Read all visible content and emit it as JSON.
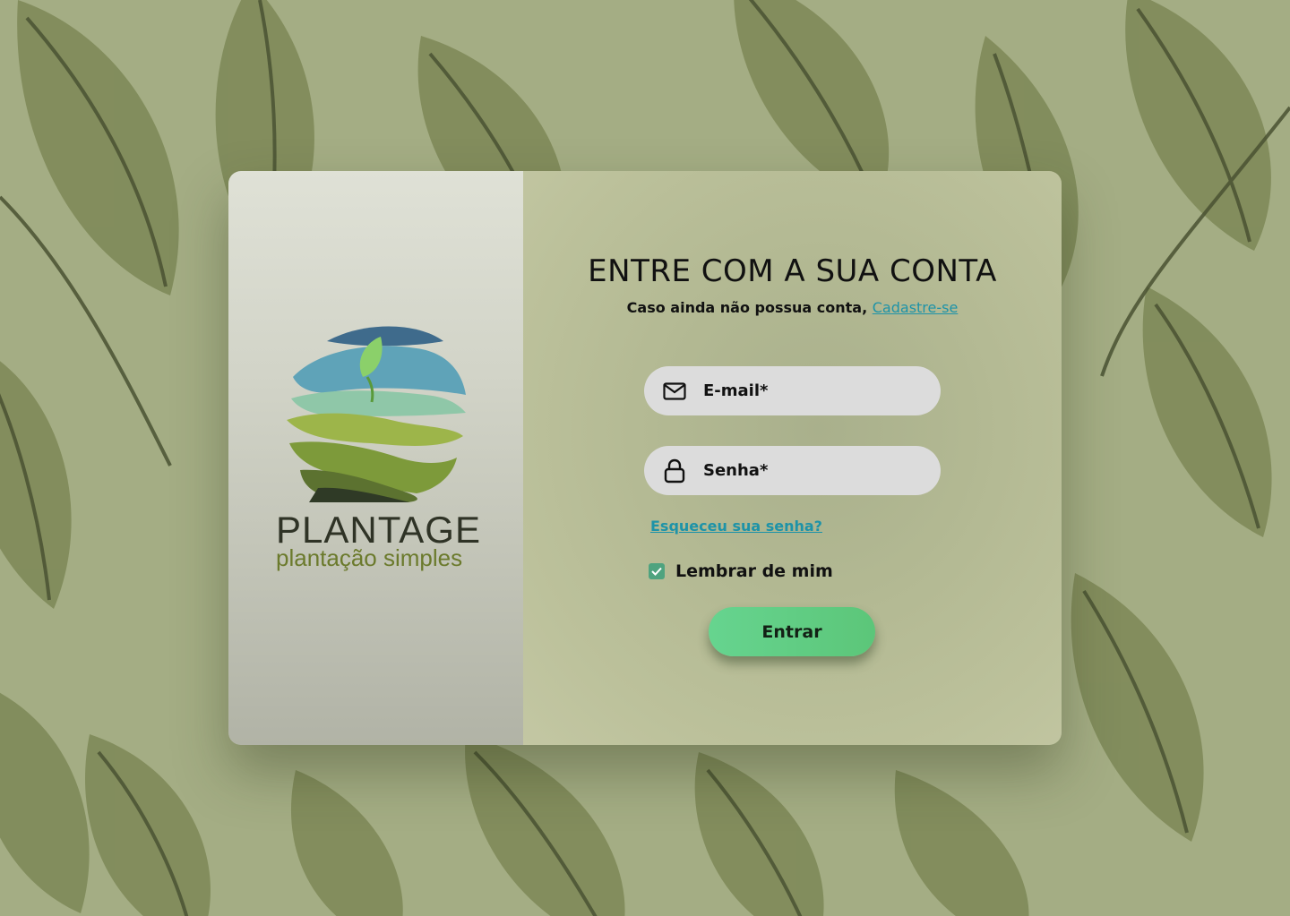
{
  "brand": {
    "name": "PLANTAGE",
    "tagline": "plantação simples"
  },
  "login": {
    "title": "ENTRE COM A SUA CONTA",
    "subtitle_text": "Caso ainda não possua conta,",
    "signup_link": "Cadastre-se",
    "email_placeholder": "E-mail*",
    "password_placeholder": "Senha*",
    "forgot_link": "Esqueceu sua senha?",
    "remember_label": "Lembrar de mim",
    "remember_checked": true,
    "submit_label": "Entrar"
  },
  "icons": {
    "email": "mail-icon",
    "password": "lock-icon",
    "checkbox": "check-icon"
  },
  "colors": {
    "link": "#1e93a8",
    "button": "#5cc679",
    "checkbox": "#4fa37f",
    "background": "#a4ad84"
  }
}
